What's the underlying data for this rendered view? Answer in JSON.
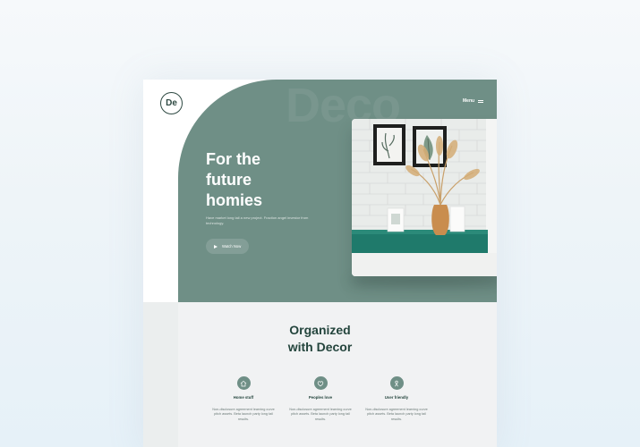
{
  "logo": {
    "text": "De"
  },
  "nav": {
    "menu_label": "Menu",
    "menu_icon": "hamburger-icon"
  },
  "hero": {
    "watermark": "Deco",
    "title_lines": [
      "For the",
      "future",
      "homies"
    ],
    "subtitle": "Have market long tail a new project. Fraction angel investor from technology.",
    "cta_label": "Watch Now",
    "cta_icon": "play-icon"
  },
  "section": {
    "title_lines": [
      "Organized",
      "with Decor"
    ],
    "features": [
      {
        "icon": "home-icon",
        "title": "Home stuff",
        "text": "Non-disclosure agreement learning curve pitch assets. Beta launch party long tail results."
      },
      {
        "icon": "heart-icon",
        "title": "Peoples love",
        "text": "Non-disclosure agreement learning curve pitch assets. Beta launch party long tail results."
      },
      {
        "icon": "user-icon",
        "title": "User friendly",
        "text": "Non-disclosure agreement learning curve pitch assets. Beta launch party long tail results."
      }
    ]
  },
  "colors": {
    "accent": "#6f8f86",
    "dark": "#24453d",
    "background": "#f1f2f3"
  }
}
